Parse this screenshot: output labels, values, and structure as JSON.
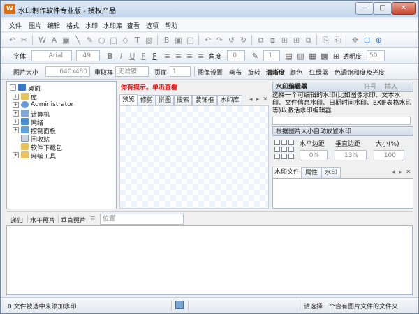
{
  "window": {
    "title": "水印制作软件专业版 - 授权产品",
    "app_icon_label": "W",
    "min_glyph": "—",
    "max_glyph": "□",
    "close_glyph": "✕"
  },
  "menu": [
    "文件",
    "图片",
    "编辑",
    "格式",
    "水印",
    "水印库",
    "查看",
    "选项",
    "帮助"
  ],
  "toolbar1": {
    "icons": [
      "undo-icon",
      "cut-icon",
      "watermark-icon",
      "text-icon",
      "image-icon",
      "line-icon",
      "pen-icon",
      "ellipse-icon",
      "rect-icon",
      "shape-icon",
      "text-tool-icon",
      "picture-tool-icon",
      "undo-icon",
      "redo-icon",
      "rotate-left-icon",
      "rotate-right-icon",
      "group-icon",
      "ungroup-icon",
      "align-icon",
      "copy-icon",
      "paste-icon",
      "move-icon",
      "fit-icon",
      "zoom-icon"
    ],
    "glyphs": [
      "↶",
      "✂",
      "W",
      "A",
      "▣",
      "╲",
      "✎",
      "○",
      "□",
      "◇",
      "T",
      "▨",
      "↶",
      "↷",
      "↺",
      "↻",
      "⧉",
      "⧈",
      "⊞",
      "⎘",
      "⎗",
      "✥",
      "⊡",
      "⊕"
    ]
  },
  "toolbar2": {
    "font_label": "字体",
    "font_value": "Arial",
    "size_value": "49",
    "bold": "B",
    "italic": "I",
    "underline": "U",
    "fontcolor": "F",
    "angle_label": "角度",
    "angle_value": "0",
    "stroke_value": "1",
    "opacity_label": "透明度",
    "opacity_value": "50"
  },
  "toolbar3": {
    "image_size_label": "图片大小",
    "image_size_value": "640x480",
    "resample_label": "重取样",
    "filter_value": "无滤镜",
    "page_label": "页面",
    "page_value": "1",
    "items": [
      "图像设置",
      "画布",
      "旋转",
      "清晰度",
      "颜色",
      "红绿蓝",
      "色调饱和度及光度"
    ]
  },
  "tree": {
    "root": "桌面",
    "items": [
      "库",
      "Administrator",
      "计算机",
      "网络",
      "控制面板",
      "回收站",
      "软件下载包",
      "网编工具"
    ]
  },
  "center": {
    "hint": "你有提示。单击查看",
    "tabs": [
      "预览",
      "修剪",
      "拼图",
      "搜索",
      "装饰框",
      "水印库"
    ]
  },
  "right": {
    "header": "水印编辑器",
    "header_right1": "符号",
    "header_right2": "插入",
    "description": "选择一个可编辑的水印(比如图像水印、文本水印、文件信息水印、日期时间水印、EXIF表格水印等)以激活水印编辑器",
    "auto_label": "根据图片大小自动放置水印",
    "hmargin_label": "水平边距",
    "vmargin_label": "垂直边距",
    "size_label": "大小(%)",
    "hmargin_value": "0%",
    "vmargin_value": "13%",
    "size_value": "100",
    "tabs": [
      "水印文件",
      "属性",
      "水印"
    ]
  },
  "bottom_toolbar": {
    "items": [
      "递归",
      "水平照片",
      "垂直照片"
    ],
    "position_placeholder": "位置"
  },
  "status": {
    "left": "0 文件被选中来添加水印",
    "right": "请选择一个含有图片文件的文件夹"
  }
}
